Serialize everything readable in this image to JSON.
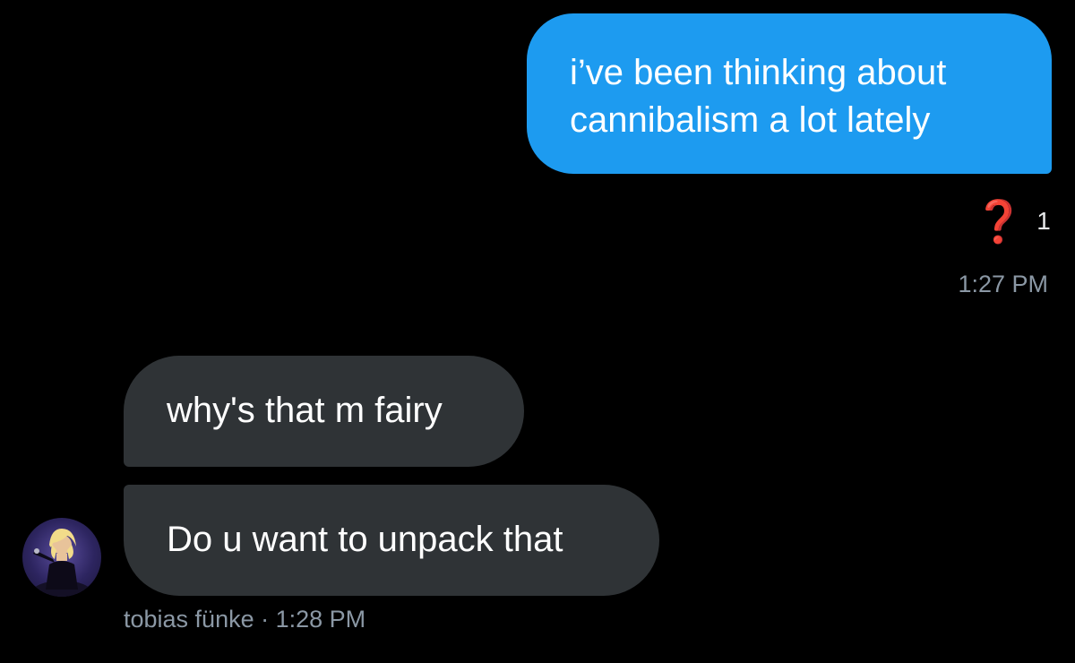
{
  "conversation": {
    "outgoing": {
      "lines": [
        "i’ve been thinking about",
        "cannibalism a lot lately"
      ],
      "reaction": {
        "emoji": "❓",
        "count": "1"
      },
      "time": "1:27 PM"
    },
    "incoming": {
      "messages": [
        "why's that m fairy",
        "Do u want to unpack that"
      ],
      "sender_name": "tobias fünke",
      "separator": " · ",
      "time": "1:28 PM",
      "avatar_icon": "user-avatar-photo"
    }
  },
  "colors": {
    "background": "#000000",
    "outgoing_bubble": "#1d9bf0",
    "incoming_bubble": "#2f3336",
    "secondary_text": "#8b98a5",
    "reaction_red": "#e0181b"
  }
}
